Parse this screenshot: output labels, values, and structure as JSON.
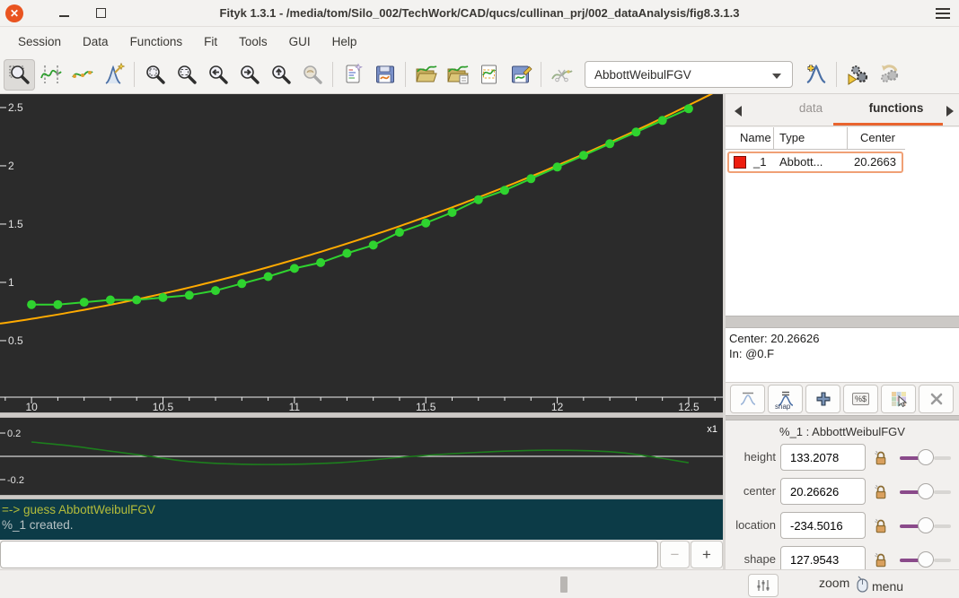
{
  "window": {
    "title": "Fityk 1.3.1 - /media/tom/Silo_002/TechWork/CAD/qucs/cullinan_prj/002_dataAnalysis/fig8.3.1.3",
    "buttons": [
      "close",
      "minimize",
      "maximize",
      "window-menu"
    ]
  },
  "menu": {
    "items": [
      "Session",
      "Data",
      "Functions",
      "Fit",
      "Tools",
      "GUI",
      "Help"
    ]
  },
  "toolbar": {
    "function_selector_value": "AbbottWeibulFGV",
    "icons": [
      "zoom-mode",
      "range-mode",
      "baseline-mode",
      "peak-draft-mode",
      "zoom-all",
      "zoom-select",
      "zoom-previous",
      "zoom-next",
      "zoom-vertical",
      "zoom-undo",
      "script-editor",
      "save-session",
      "open-data",
      "append-data",
      "export-data",
      "save-data",
      "strip-background",
      "add-function",
      "run-fit",
      "undo-fit"
    ]
  },
  "sidebar": {
    "tabs": {
      "data": "data",
      "functions": "functions"
    },
    "table": {
      "headers": [
        "Name",
        "Type",
        "Center"
      ],
      "rows": [
        {
          "swatch_color": "#ee1c0e",
          "name": "_1",
          "type": "Abbott...",
          "center": "20.2663"
        }
      ]
    },
    "info": {
      "line1": "Center: 20.26626",
      "line2": "In: @0.F"
    },
    "mini_toolbar": {
      "icons": [
        "peak-markers",
        "snap-to-data",
        "add-function",
        "value-percent",
        "grid-hand",
        "delete-function"
      ],
      "snap_text": "snap",
      "percent_text": "%$"
    },
    "params": {
      "title": "%_1 : AbbottWeibulFGV",
      "rows": [
        {
          "label": "height",
          "value": "133.2078"
        },
        {
          "label": "center",
          "value": "20.26626"
        },
        {
          "label": "location",
          "value": "-234.5016"
        },
        {
          "label": "shape",
          "value": "127.9543"
        }
      ]
    },
    "bottom": {
      "zoom_label": "zoom",
      "menu_label": "menu"
    }
  },
  "console": {
    "lines": [
      {
        "text": "=-> guess AbbottWeibulFGV",
        "color": "#b4bc3a"
      },
      {
        "text": "%_1 created.",
        "color": "#b8c3c5"
      }
    ]
  },
  "input_row": {
    "value": "",
    "decrease": "−",
    "increase": "+"
  },
  "colors": {
    "accent_orange": "#e9642e",
    "plot_background": "#2b2b2b",
    "console_background": "#0c3b47",
    "data_series": "#2fd32f",
    "model_series": "#ffaa00",
    "residual_series": "#1d7e1d",
    "close_button": "#e95420",
    "selected_row_border": "#f0a075"
  },
  "chart_data": [
    {
      "type": "line",
      "title": "",
      "xlabel": "",
      "ylabel": "",
      "grid": false,
      "xlim": [
        9.88,
        12.63
      ],
      "ylim": [
        0.015,
        2.615
      ],
      "x_ticks": [
        10,
        10.5,
        11,
        11.5,
        12,
        12.5
      ],
      "y_ticks": [
        0.5,
        1,
        1.5,
        2,
        2.5
      ],
      "series": [
        {
          "name": "data-points",
          "color": "#2fd32f",
          "marker": "circle",
          "x": [
            10.0,
            10.1,
            10.2,
            10.3,
            10.4,
            10.5,
            10.6,
            10.7,
            10.8,
            10.9,
            11.0,
            11.1,
            11.2,
            11.3,
            11.4,
            11.5,
            11.6,
            11.7,
            11.8,
            11.9,
            12.0,
            12.1,
            12.2,
            12.3,
            12.4,
            12.5
          ],
          "y": [
            0.81,
            0.81,
            0.83,
            0.85,
            0.85,
            0.87,
            0.89,
            0.93,
            0.99,
            1.05,
            1.12,
            1.17,
            1.25,
            1.32,
            1.43,
            1.51,
            1.6,
            1.71,
            1.79,
            1.89,
            1.99,
            2.09,
            2.19,
            2.29,
            2.39,
            2.49
          ]
        },
        {
          "name": "model-fit-AbbottWeibulFGV",
          "color": "#ffaa00",
          "quadratic": {
            "a": 0.687,
            "b": 0.358,
            "c": 0.15,
            "x0": 10
          }
        }
      ]
    },
    {
      "type": "line",
      "name": "residuals",
      "scale_label": "x1",
      "color": "#1d7e1d",
      "xlim": [
        9.88,
        12.63
      ],
      "ylim": [
        -0.331,
        0.331
      ],
      "y_ticks": [
        0.2,
        -0.2
      ],
      "x": [
        10.0,
        10.15,
        10.3,
        10.45,
        10.6,
        10.8,
        11.0,
        11.2,
        11.45,
        11.7,
        11.95,
        12.2,
        12.35,
        12.5
      ],
      "y": [
        0.123,
        0.09,
        0.045,
        0,
        -0.045,
        -0.068,
        -0.068,
        -0.05,
        0,
        0.035,
        0.052,
        0.04,
        0,
        -0.055
      ]
    }
  ]
}
